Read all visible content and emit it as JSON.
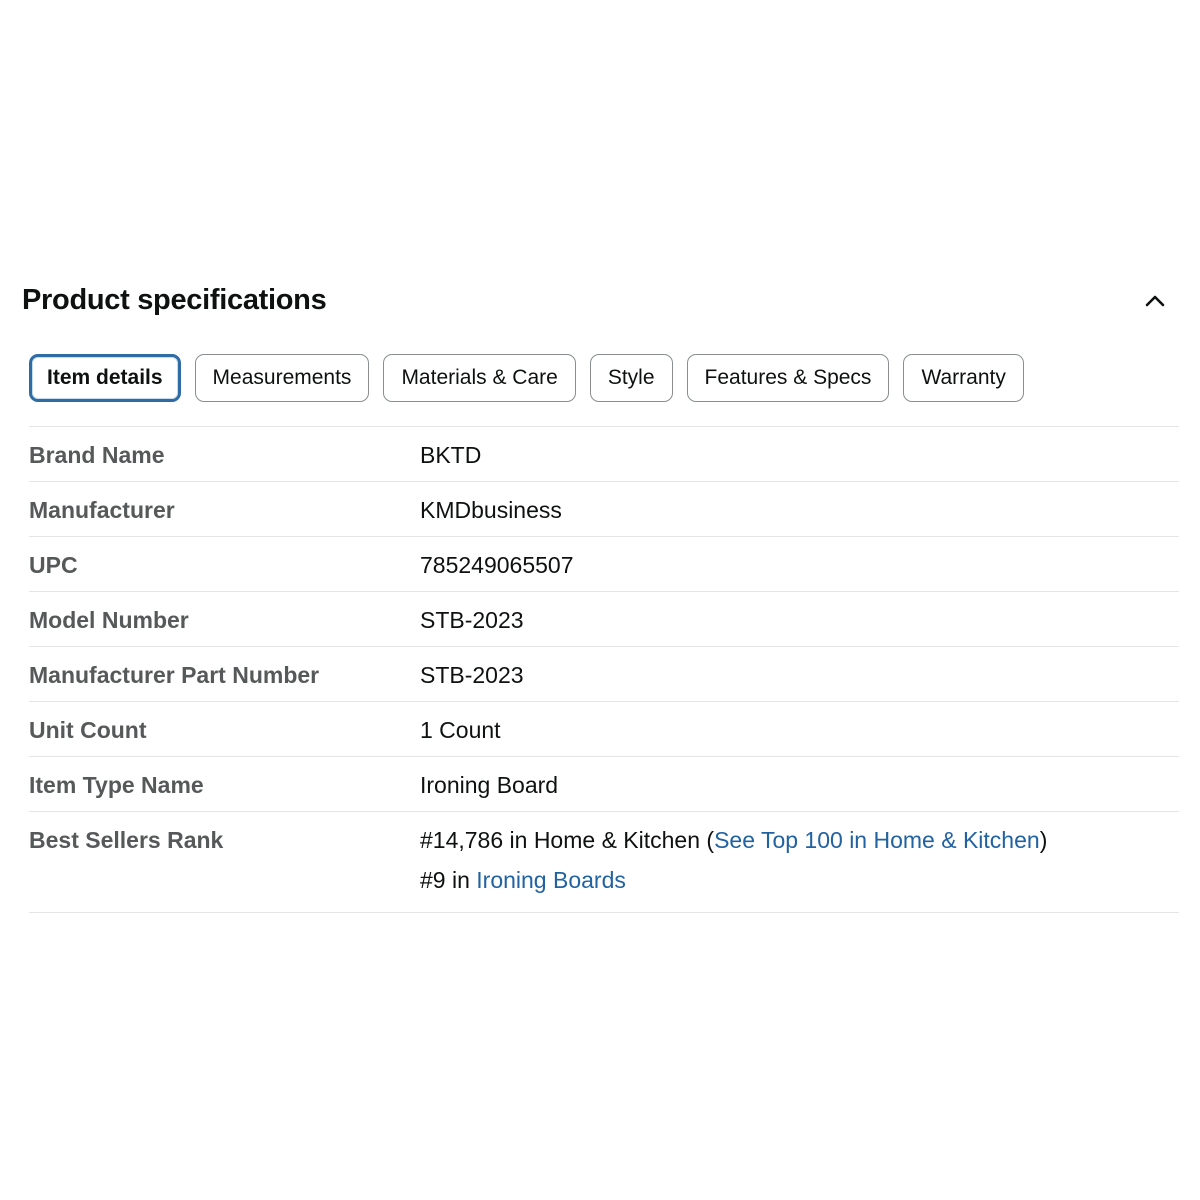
{
  "section": {
    "title": "Product specifications",
    "collapse_icon": "chevron-up-icon"
  },
  "tabs": [
    {
      "label": "Item details",
      "active": true
    },
    {
      "label": "Measurements",
      "active": false
    },
    {
      "label": "Materials & Care",
      "active": false
    },
    {
      "label": "Style",
      "active": false
    },
    {
      "label": "Features & Specs",
      "active": false
    },
    {
      "label": "Warranty",
      "active": false
    }
  ],
  "specs": [
    {
      "label": "Brand Name",
      "value": "BKTD"
    },
    {
      "label": "Manufacturer",
      "value": "KMDbusiness"
    },
    {
      "label": "UPC",
      "value": "785249065507"
    },
    {
      "label": "Model Number",
      "value": "STB-2023"
    },
    {
      "label": "Manufacturer Part Number",
      "value": "STB-2023"
    },
    {
      "label": "Unit Count",
      "value": "1 Count"
    },
    {
      "label": "Item Type Name",
      "value": "Ironing Board"
    }
  ],
  "best_sellers": {
    "label": "Best Sellers Rank",
    "line1": {
      "prefix": "#14,786 in Home & Kitchen (",
      "link": "See Top 100 in Home & Kitchen",
      "suffix": ")"
    },
    "line2": {
      "prefix": "#9 in ",
      "link": "Ironing Boards"
    }
  },
  "colors": {
    "link": "#2162a1",
    "active_tab_border": "#2e6ca3",
    "label_text": "#565959",
    "divider": "#e3e6e6"
  }
}
